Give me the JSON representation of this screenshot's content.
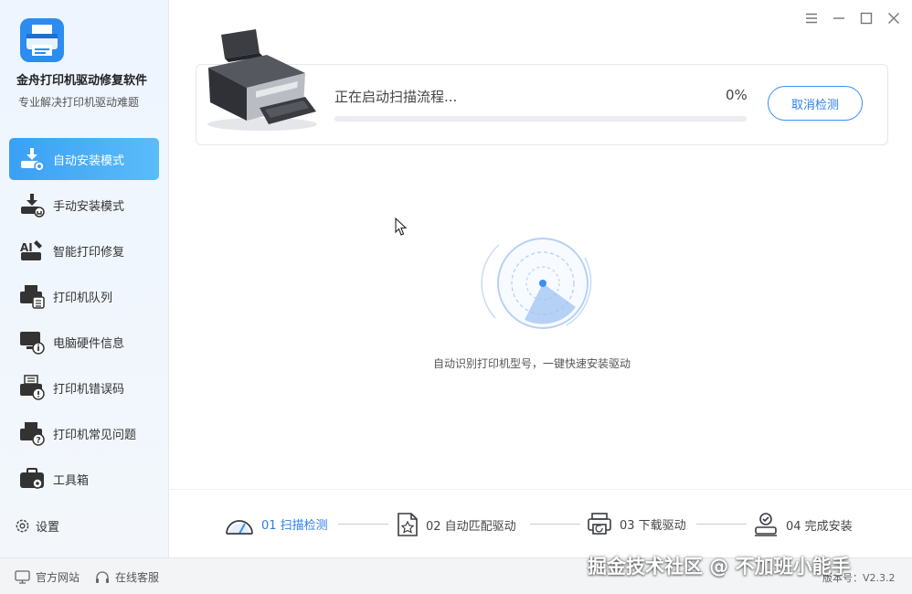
{
  "app": {
    "title": "金舟打印机驱动修复软件",
    "subtitle": "专业解决打印机驱动难题"
  },
  "sidebar": {
    "items": [
      {
        "label": "自动安装模式",
        "icon": "auto-install-icon",
        "active": true
      },
      {
        "label": "手动安装模式",
        "icon": "manual-install-icon",
        "active": false
      },
      {
        "label": "智能打印修复",
        "icon": "ai-repair-icon",
        "active": false
      },
      {
        "label": "打印机队列",
        "icon": "printer-queue-icon",
        "active": false
      },
      {
        "label": "电脑硬件信息",
        "icon": "hardware-info-icon",
        "active": false
      },
      {
        "label": "打印机错误码",
        "icon": "error-code-icon",
        "active": false
      },
      {
        "label": "打印机常见问题",
        "icon": "faq-icon",
        "active": false
      },
      {
        "label": "工具箱",
        "icon": "toolbox-icon",
        "active": false
      }
    ],
    "settings_label": "设置"
  },
  "scan": {
    "status_text": "正在启动扫描流程...",
    "percent_text": "0%",
    "progress": 0,
    "cancel_label": "取消检测",
    "caption": "自动识别打印机型号，一键快速安装驱动"
  },
  "steps": [
    {
      "label": "01 扫描检测",
      "icon": "scan-gauge-icon",
      "active": true
    },
    {
      "label": "02 自动匹配驱动",
      "icon": "match-document-icon",
      "active": false
    },
    {
      "label": "03 下载驱动",
      "icon": "download-printer-icon",
      "active": false
    },
    {
      "label": "04 完成安装",
      "icon": "complete-check-icon",
      "active": false
    }
  ],
  "footer": {
    "website_label": "官方网站",
    "support_label": "在线客服",
    "version_label": "版本号：V2.3.2",
    "watermark": "掘金技术社区 @ 不加班小能手"
  },
  "colors": {
    "accent": "#3a8ef5",
    "active_nav": "#3aa0f5"
  }
}
